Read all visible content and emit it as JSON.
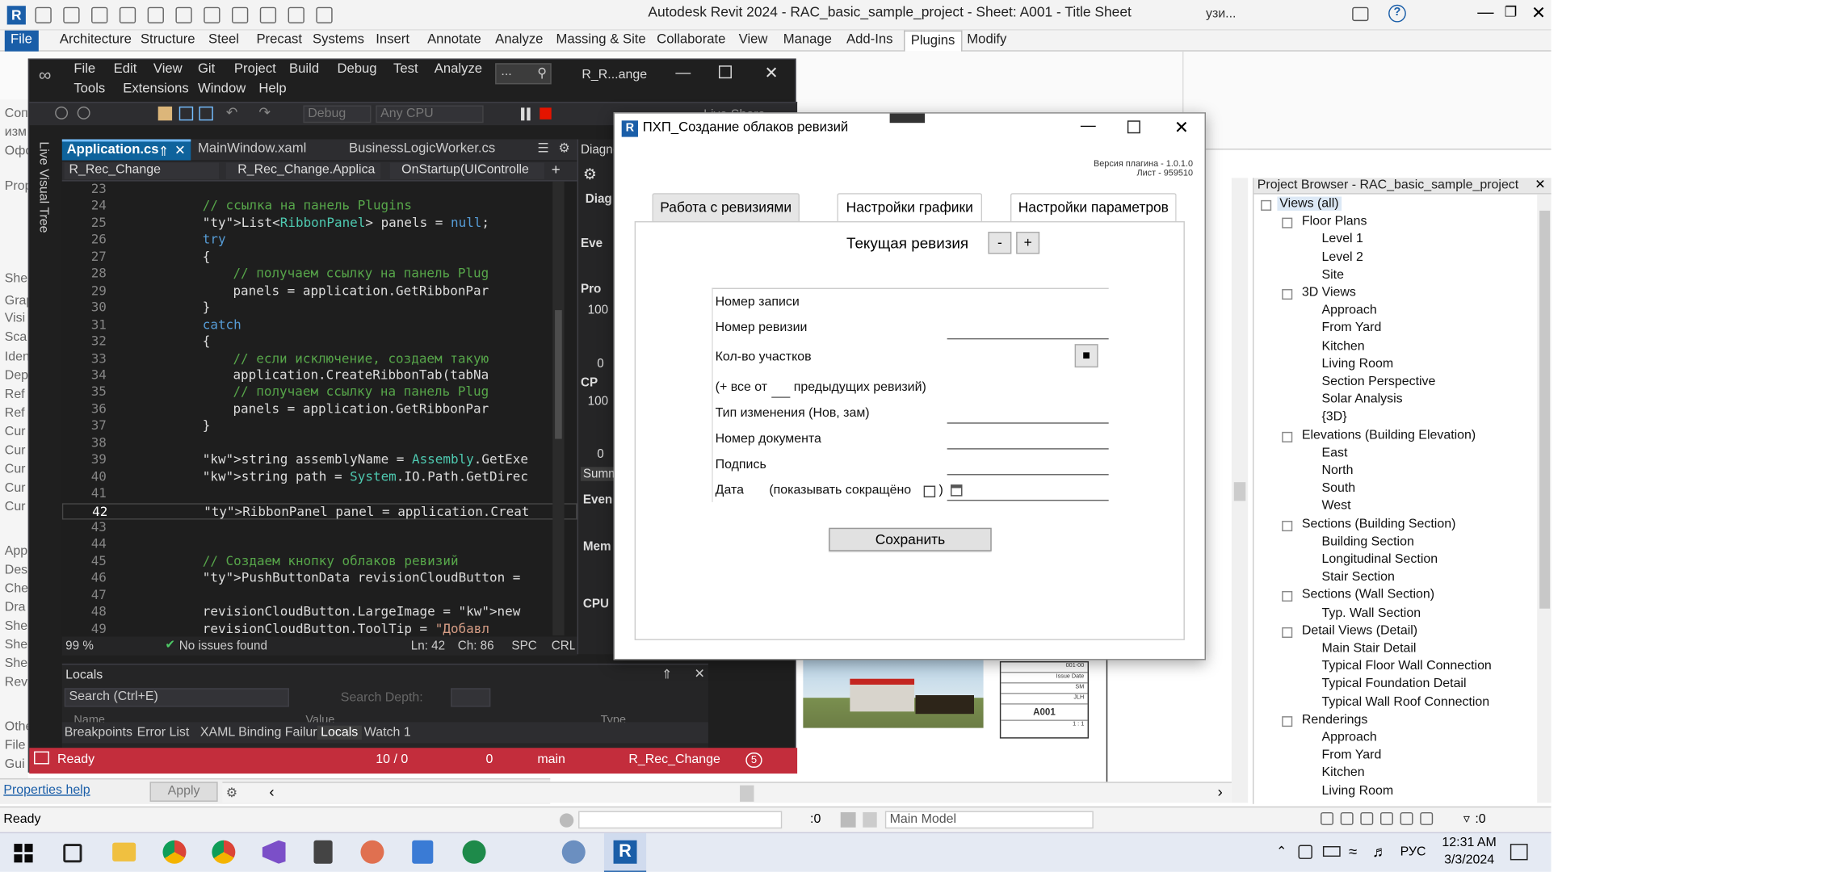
{
  "revit": {
    "title": "Autodesk Revit 2024 - RAC_basic_sample_project - Sheet: A001 - Title Sheet",
    "user": "узи...",
    "ribbon_tabs": [
      "File",
      "Architecture",
      "Structure",
      "Steel",
      "Precast",
      "Systems",
      "Insert",
      "Annotate",
      "Analyze",
      "Massing & Site",
      "Collaborate",
      "View",
      "Manage",
      "Add-Ins",
      "Plugins",
      "Modify"
    ],
    "active_tab": "Plugins",
    "left_labels": [
      "Соп",
      "изм",
      "Офо",
      "Prop",
      "Shee",
      "Grap",
      "Visi",
      "Sca",
      "Ident",
      "Dep",
      "Ref",
      "Ref",
      "Cur",
      "Cur",
      "Cur",
      "Cur",
      "Cur",
      "App",
      "Des",
      "Che",
      "Dra",
      "She",
      "She",
      "She",
      "Rev",
      "Othe",
      "File",
      "Gui"
    ],
    "properties_help": "Properties help",
    "apply": "Apply",
    "status": "Ready",
    "status_zero": ":0",
    "main_model": "Main Model",
    "filter_count": ":0"
  },
  "vs": {
    "menu_row1": [
      "File",
      "Edit",
      "View",
      "Git",
      "Project",
      "Build",
      "Debug",
      "Test",
      "Analyze"
    ],
    "menu_row2": [
      "Tools",
      "Extensions",
      "Window",
      "Help"
    ],
    "search": "...",
    "solution": "R_R...ange",
    "debug": "Debug",
    "cpu": "Any CPU",
    "live_share": "Live Share",
    "vertical_tab": "Live Visual Tree",
    "tabs": [
      "Application.cs",
      "MainWindow.xaml",
      "BusinessLogicWorker.cs"
    ],
    "nav": [
      "R_Rec_Change",
      "R_Rec_Change.Applica",
      "OnStartup(UIControlle"
    ],
    "lines": [
      {
        "n": "23",
        "t": ""
      },
      {
        "n": "24",
        "t": "// ссылка на панель Plugins",
        "c": "cm",
        "i": 0
      },
      {
        "n": "25",
        "t": "List<RibbonPanel> panels = null;",
        "i": 0
      },
      {
        "n": "26",
        "t": "try",
        "c": "kw",
        "i": 0
      },
      {
        "n": "27",
        "t": "{",
        "i": 0
      },
      {
        "n": "28",
        "t": "// получаем ссылку на панель Plug",
        "c": "cm",
        "i": 1
      },
      {
        "n": "29",
        "t": "panels = application.GetRibbonPar",
        "i": 1
      },
      {
        "n": "30",
        "t": "}",
        "i": 0
      },
      {
        "n": "31",
        "t": "catch",
        "c": "kw",
        "i": 0
      },
      {
        "n": "32",
        "t": "{",
        "i": 0
      },
      {
        "n": "33",
        "t": "// если исключение, создаем такую",
        "c": "cm",
        "i": 1
      },
      {
        "n": "34",
        "t": "application.CreateRibbonTab(tabNa",
        "i": 1
      },
      {
        "n": "35",
        "t": "// получаем ссылку на панель Plug",
        "c": "cm",
        "i": 1
      },
      {
        "n": "36",
        "t": "panels = application.GetRibbonPar",
        "i": 1
      },
      {
        "n": "37",
        "t": "}",
        "i": 0
      },
      {
        "n": "38",
        "t": ""
      },
      {
        "n": "39",
        "t": "string assemblyName = Assembly.GetExe",
        "i": 0
      },
      {
        "n": "40",
        "t": "string path = System.IO.Path.GetDirec",
        "i": 0
      },
      {
        "n": "41",
        "t": ""
      },
      {
        "n": "42",
        "t": "RibbonPanel panel = application.Creat",
        "i": 0
      },
      {
        "n": "43",
        "t": ""
      },
      {
        "n": "44",
        "t": ""
      },
      {
        "n": "45",
        "t": "// Создаем кнопку облаков ревизий",
        "c": "cm",
        "i": 0
      },
      {
        "n": "46",
        "t": "PushButtonData revisionCloudButton =",
        "i": 0
      },
      {
        "n": "47",
        "t": ""
      },
      {
        "n": "48",
        "t": "revisionCloudButton.LargeImage = new",
        "i": 0
      },
      {
        "n": "49",
        "t": "revisionCloudButton.ToolTip = \"Добавл",
        "i": 0
      }
    ],
    "zoom": "99 %",
    "issues": "No issues found",
    "ln": "Ln: 42",
    "ch": "Ch: 86",
    "spc": "SPC",
    "crlf": "CRL",
    "diag": {
      "title": "Diagno",
      "diag2": "Diag",
      "eve": "Eve",
      "pro": "Pro",
      "v100a": "100",
      "v0a": "0",
      "cp": "CP",
      "v100b": "100",
      "v0b": "0",
      "summ": "Summ",
      "events": "Even",
      "mem": "Mem",
      "cpu": "CPU"
    },
    "locals_title": "Locals",
    "locals_search": "Search (Ctrl+E)",
    "search_depth": "Search Depth:",
    "cols": [
      "Name",
      "Value",
      "Type"
    ],
    "bottom_tabs": [
      "Breakpoints",
      "Error List",
      "XAML Binding Failures",
      "Locals",
      "Watch 1"
    ],
    "status": {
      "ready": "Ready",
      "lines": "10 / 0",
      "edits": "0",
      "branch": "main",
      "repo": "R_Rec_Change",
      "notif": "5"
    }
  },
  "dialog": {
    "title": "ПХП_Создание облаков ревизий",
    "version": "Версия плагина - 1.0.1.0",
    "sheet": "Лист - 959510",
    "tabs": [
      "Работа с ревизиями",
      "Настройки графики",
      "Настройки параметров"
    ],
    "current_revision": "Текущая ревизия",
    "minus": "-",
    "plus": "+",
    "fields": {
      "record": "Номер записи",
      "revision": "Номер ревизии",
      "sections": "Кол-во участков",
      "all_from": "(+ все от",
      "prev": "предыдущих ревизий)",
      "change_type": "Тип изменения (Нов, зам)",
      "doc_number": "Номер документа",
      "signature": "Подпись",
      "date": "Дата",
      "short": "(показывать сокращёно",
      "close_paren": ")"
    },
    "save": "Сохранить"
  },
  "sheet": {
    "rows": [
      "Issue Date",
      "SM",
      "JLH"
    ],
    "code": "001-00",
    "number": "A001",
    "scale": "1 : 1"
  },
  "browser": {
    "title": "Project Browser - RAC_basic_sample_project",
    "items": [
      {
        "t": "Views (all)",
        "l": 0,
        "b": "-"
      },
      {
        "t": "Floor Plans",
        "l": 1,
        "b": "-"
      },
      {
        "t": "Level 1",
        "l": 2
      },
      {
        "t": "Level 2",
        "l": 2
      },
      {
        "t": "Site",
        "l": 2
      },
      {
        "t": "3D Views",
        "l": 1,
        "b": "-"
      },
      {
        "t": "Approach",
        "l": 2
      },
      {
        "t": "From Yard",
        "l": 2
      },
      {
        "t": "Kitchen",
        "l": 2
      },
      {
        "t": "Living Room",
        "l": 2
      },
      {
        "t": "Section Perspective",
        "l": 2
      },
      {
        "t": "Solar Analysis",
        "l": 2
      },
      {
        "t": "{3D}",
        "l": 2
      },
      {
        "t": "Elevations (Building Elevation)",
        "l": 1,
        "b": "-"
      },
      {
        "t": "East",
        "l": 2
      },
      {
        "t": "North",
        "l": 2
      },
      {
        "t": "South",
        "l": 2
      },
      {
        "t": "West",
        "l": 2
      },
      {
        "t": "Sections (Building Section)",
        "l": 1,
        "b": "-"
      },
      {
        "t": "Building Section",
        "l": 2
      },
      {
        "t": "Longitudinal Section",
        "l": 2
      },
      {
        "t": "Stair Section",
        "l": 2
      },
      {
        "t": "Sections (Wall Section)",
        "l": 1,
        "b": "-"
      },
      {
        "t": "Typ. Wall Section",
        "l": 2
      },
      {
        "t": "Detail Views (Detail)",
        "l": 1,
        "b": "-"
      },
      {
        "t": "Main Stair Detail",
        "l": 2
      },
      {
        "t": "Typical Floor Wall Connection",
        "l": 2
      },
      {
        "t": "Typical Foundation Detail",
        "l": 2
      },
      {
        "t": "Typical Wall Roof Connection",
        "l": 2
      },
      {
        "t": "Renderings",
        "l": 1,
        "b": "-"
      },
      {
        "t": "Approach",
        "l": 2
      },
      {
        "t": "From Yard",
        "l": 2
      },
      {
        "t": "Kitchen",
        "l": 2
      },
      {
        "t": "Living Room",
        "l": 2
      }
    ]
  },
  "taskbar": {
    "lang": "РУС",
    "time": "12:31 AM",
    "date": "3/3/2024"
  }
}
